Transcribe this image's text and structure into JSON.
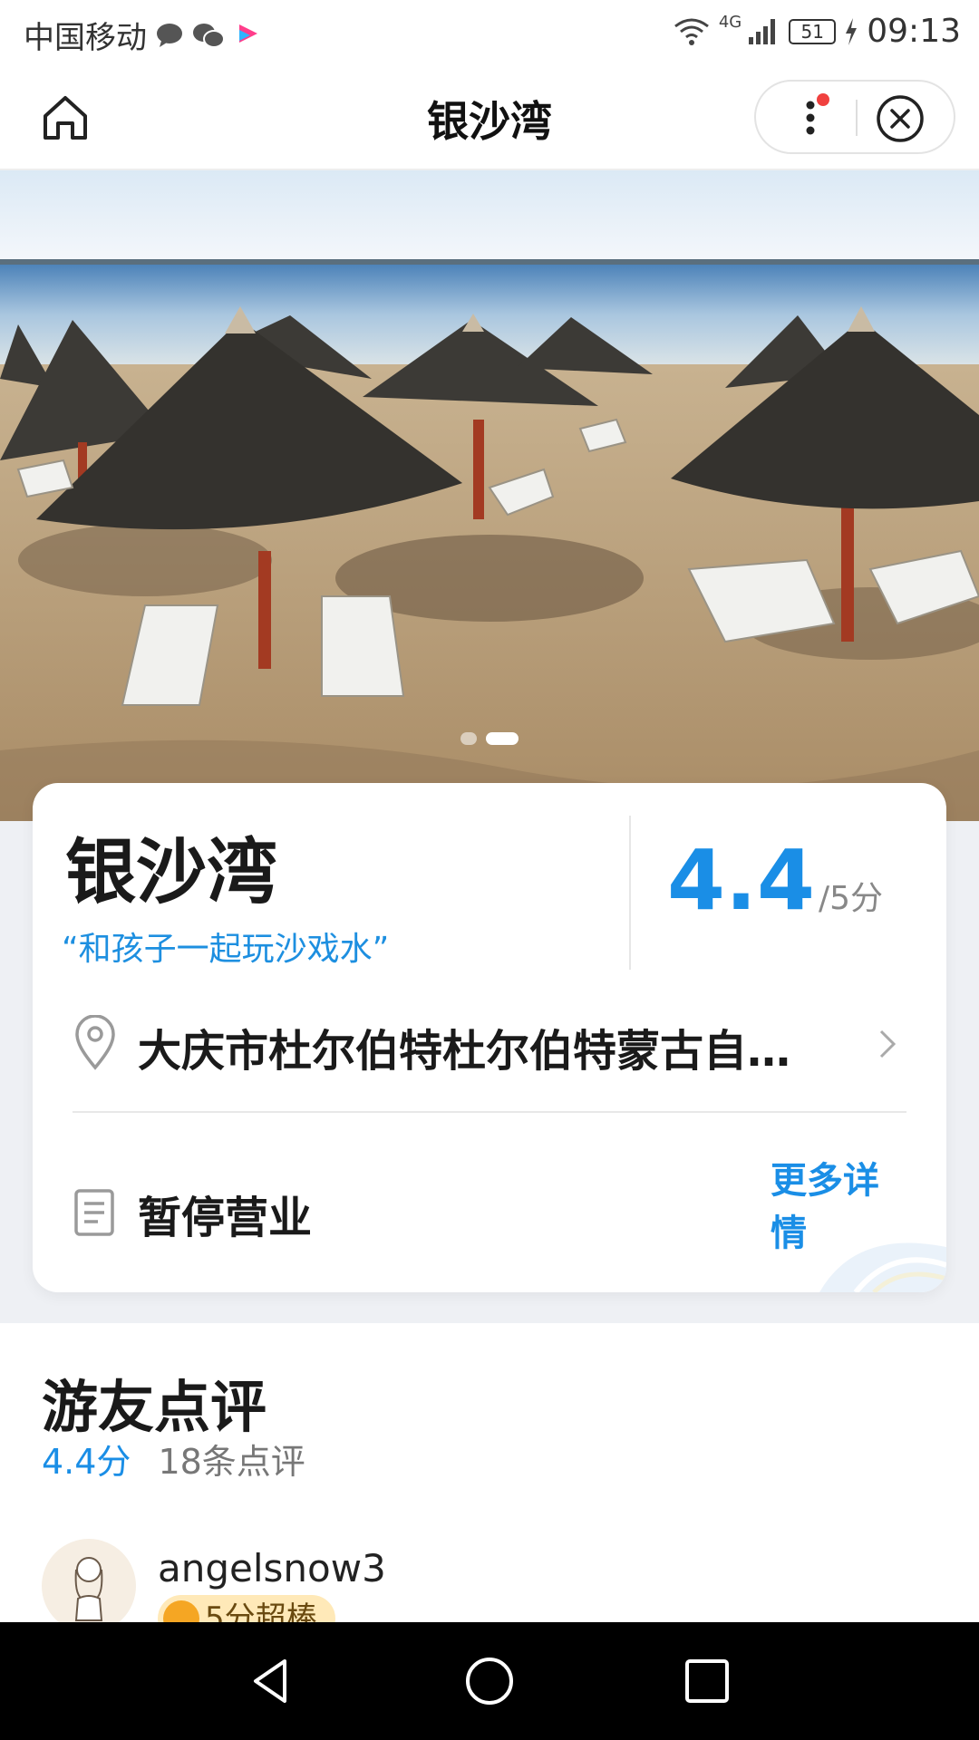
{
  "status_bar": {
    "carrier": "中国移动",
    "network": "4G",
    "battery": "51",
    "time": "09:13"
  },
  "nav": {
    "title": "银沙湾",
    "icons": [
      "home-icon",
      "more-dots-icon",
      "close-circle-icon"
    ]
  },
  "hero": {
    "image_alt": "beach umbrellas",
    "slides": 2,
    "active_slide": 2
  },
  "card": {
    "name": "银沙湾",
    "slogan": "“和孩子一起玩沙戏水”",
    "rating": "4.4",
    "rating_suffix": "/5分",
    "address": "大庆市杜尔伯特杜尔伯特蒙古自…",
    "status": "暂停营业",
    "more_link": "更多详情"
  },
  "reviews": {
    "title": "游友点评",
    "score": "4.4分",
    "count": "18条点评",
    "first_review": {
      "user": "angelsnow3",
      "badge": "5分超棒"
    }
  },
  "colors": {
    "accent": "#1a8ee6",
    "background_band": "#eef0f4"
  }
}
